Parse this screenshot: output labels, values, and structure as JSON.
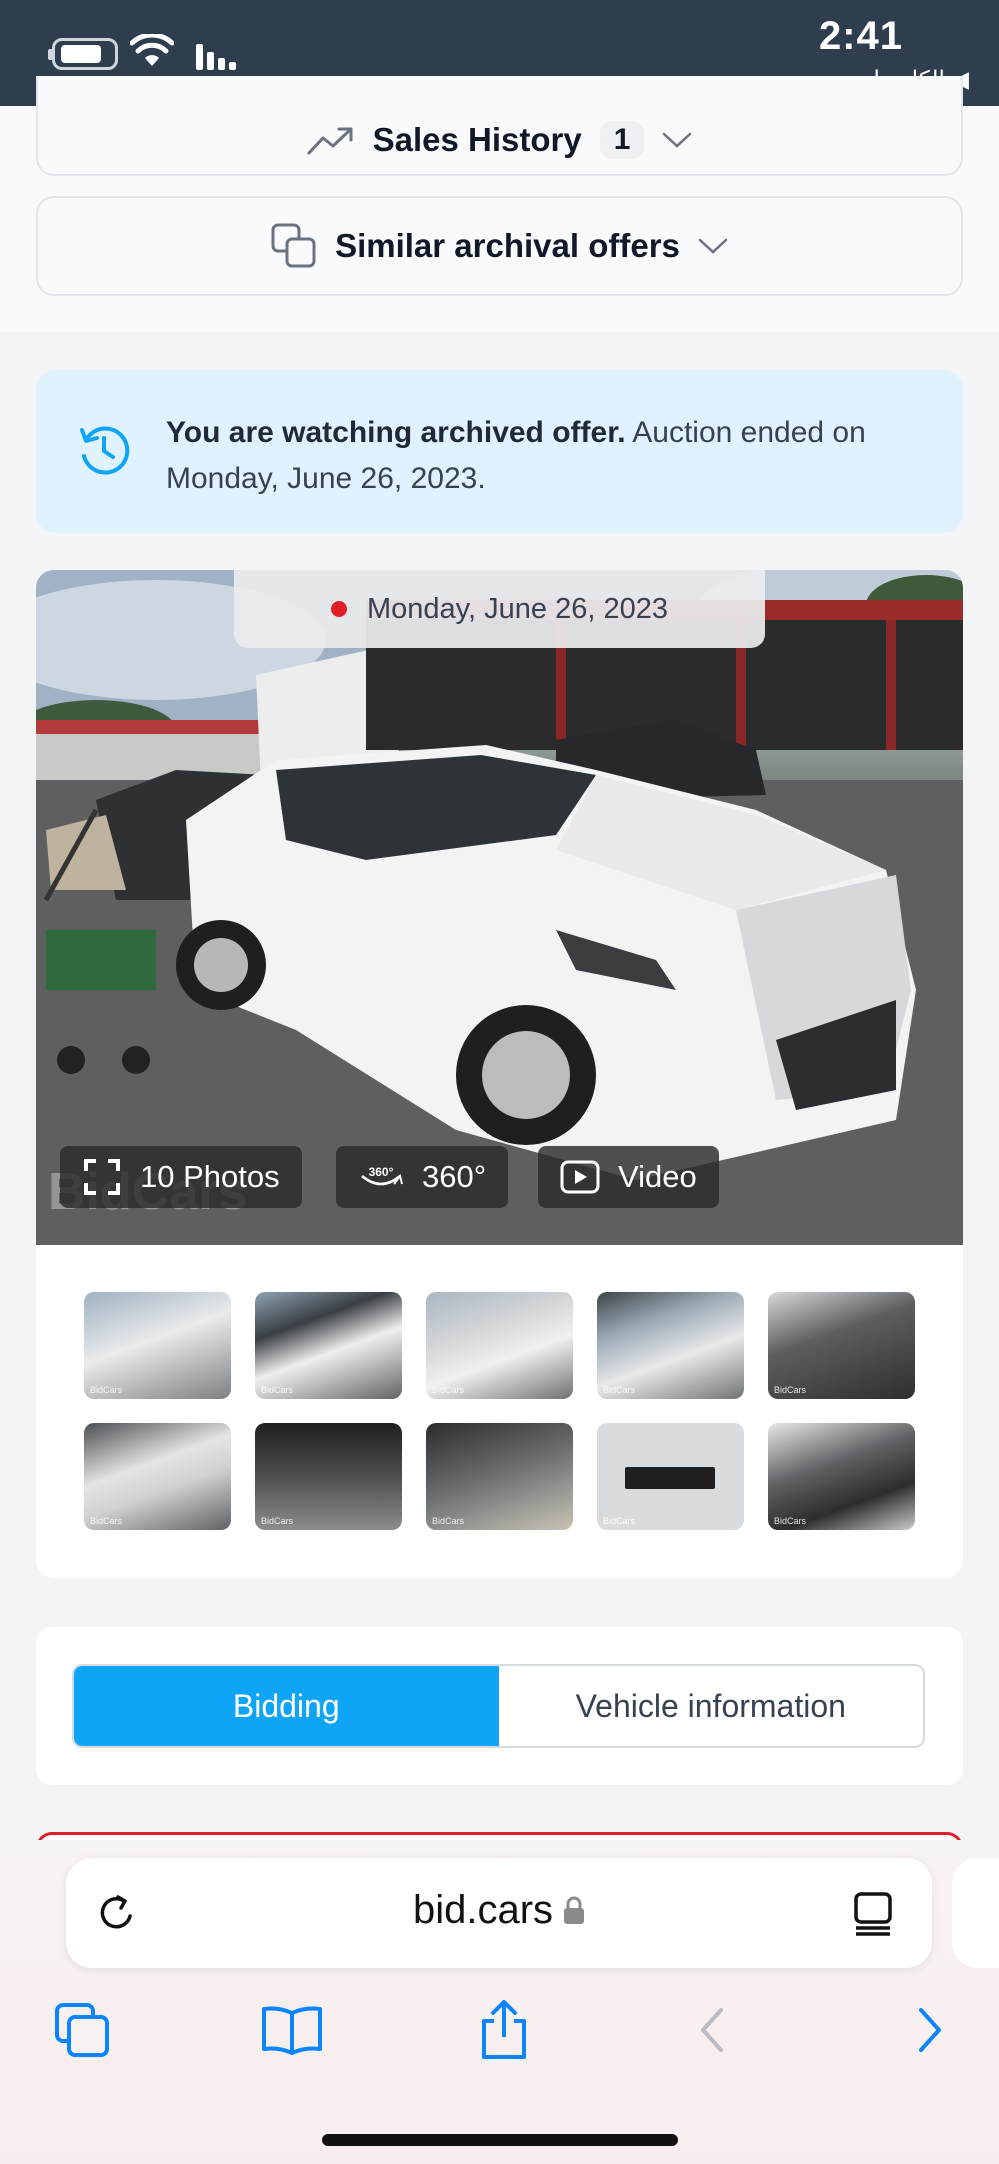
{
  "status_bar": {
    "time": "2:41",
    "back_label": "◀ الكاميرا",
    "icons": [
      "battery-icon",
      "wifi-icon",
      "signal-icon"
    ]
  },
  "sales_history": {
    "label": "Sales History",
    "count": "1"
  },
  "similar_offers": {
    "label": "Similar archival offers"
  },
  "archived_notice": {
    "bold": "You are watching archived offer.",
    "rest": " Auction ended on Monday, June 26, 2023."
  },
  "hero": {
    "date": "Monday, June 26, 2023",
    "watermark": "BidCars",
    "buttons": {
      "photos": "10 Photos",
      "rotate": "360°",
      "video": "Video"
    }
  },
  "thumbnails": [
    {
      "name": "thumb-1"
    },
    {
      "name": "thumb-2"
    },
    {
      "name": "thumb-3"
    },
    {
      "name": "thumb-4"
    },
    {
      "name": "thumb-5"
    },
    {
      "name": "thumb-6"
    },
    {
      "name": "thumb-7"
    },
    {
      "name": "thumb-8"
    },
    {
      "name": "thumb-9"
    },
    {
      "name": "thumb-10"
    }
  ],
  "thumb_watermark": "BidCars",
  "tabs": {
    "bidding": "Bidding",
    "vehicle_info": "Vehicle information",
    "active": "bidding"
  },
  "browser": {
    "url": "bid.cars"
  },
  "colors": {
    "accent": "#0ea5f6",
    "status_bar": "#2f3e4e",
    "alert_bg": "#e0f2fd",
    "live_dot": "#e11d2a"
  }
}
